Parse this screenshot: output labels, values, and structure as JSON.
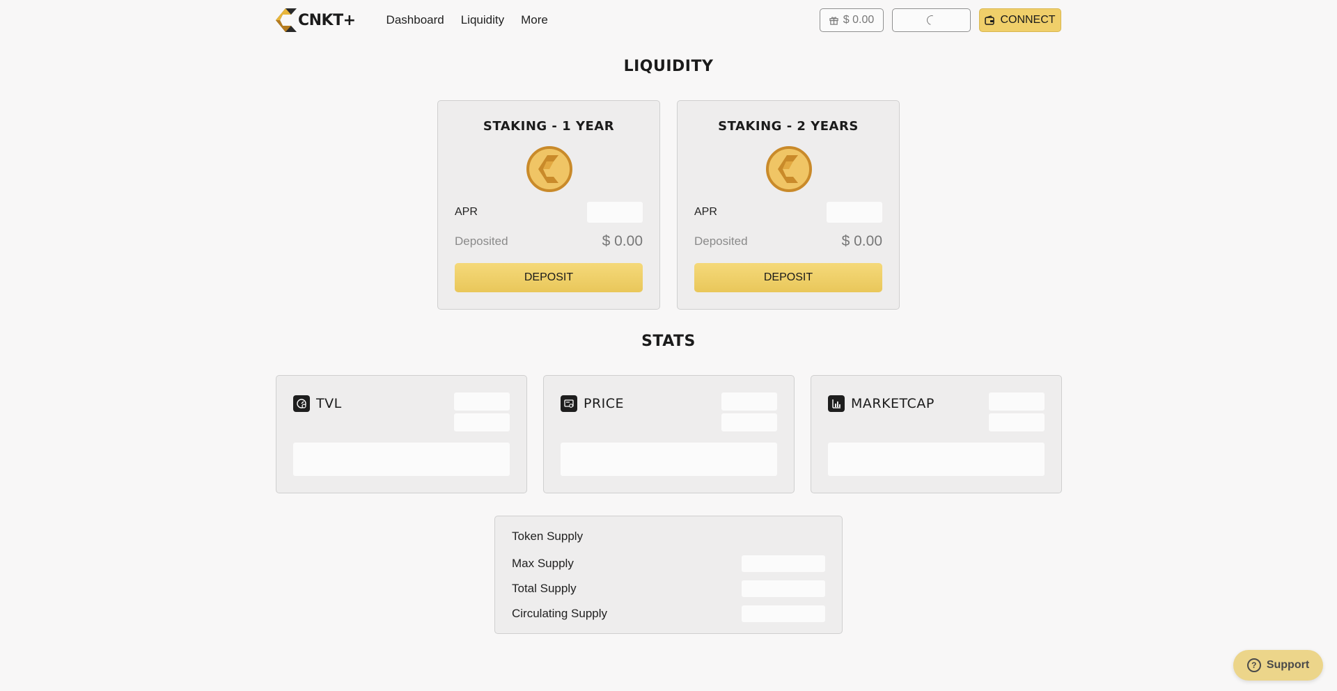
{
  "header": {
    "brand": "CNKT+",
    "nav": [
      {
        "label": "Dashboard"
      },
      {
        "label": "Liquidity"
      },
      {
        "label": "More"
      }
    ],
    "balance": "$ 0.00",
    "connect_label": "CONNECT"
  },
  "colors": {
    "accent": "#f0cf6a",
    "coin": "#c98a2a",
    "card_bg": "#eeeded",
    "page_bg": "#f8f7f7"
  },
  "liquidity": {
    "title": "LIQUIDITY",
    "cards": [
      {
        "title": "STAKING - 1 YEAR",
        "apr_label": "APR",
        "deposited_label": "Deposited",
        "deposited_value": "$ 0.00",
        "button": "DEPOSIT"
      },
      {
        "title": "STAKING - 2 YEARS",
        "apr_label": "APR",
        "deposited_label": "Deposited",
        "deposited_value": "$ 0.00",
        "button": "DEPOSIT"
      }
    ]
  },
  "stats": {
    "title": "STATS",
    "cards": [
      {
        "label": "TVL",
        "icon": "tvl-gauge-icon"
      },
      {
        "label": "PRICE",
        "icon": "price-tag-icon"
      },
      {
        "label": "MARKETCAP",
        "icon": "bar-chart-icon"
      }
    ]
  },
  "supply": {
    "title": "Token Supply",
    "rows": [
      {
        "label": "Max Supply"
      },
      {
        "label": "Total Supply"
      },
      {
        "label": "Circulating Supply"
      }
    ]
  },
  "support": {
    "label": "Support"
  }
}
